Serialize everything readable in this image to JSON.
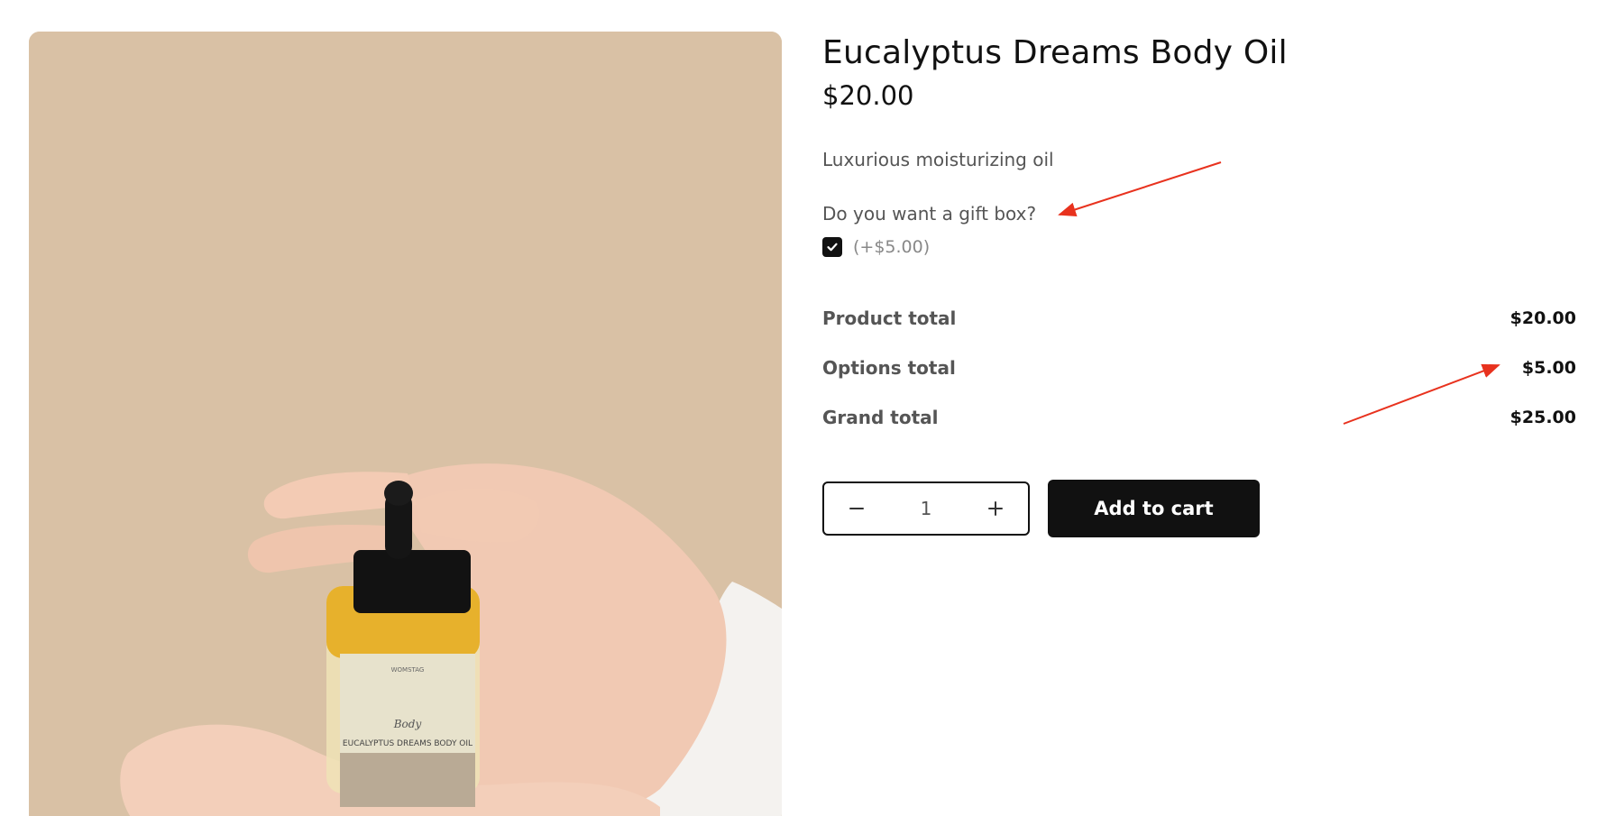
{
  "product": {
    "title": "Eucalyptus Dreams Body Oil",
    "price": "$20.00",
    "description": "Luxurious moisturizing oil",
    "image_label_brand": "WOMSTAG",
    "image_label_category": "Body",
    "image_label_name": "EUCALYPTUS DREAMS BODY OIL"
  },
  "options": {
    "question": "Do you want a gift box?",
    "gift_box_checked": true,
    "gift_box_price": "(+$5.00)"
  },
  "totals": {
    "product_total_label": "Product total",
    "product_total_value": "$20.00",
    "options_total_label": "Options total",
    "options_total_value": "$5.00",
    "grand_total_label": "Grand total",
    "grand_total_value": "$25.00"
  },
  "cart": {
    "quantity": "1",
    "add_to_cart_label": "Add to cart"
  },
  "colors": {
    "accent": "#111111",
    "annotation_arrow": "#e8321e",
    "image_background": "#d9c0a3"
  },
  "icons": {
    "checkbox": "check-icon",
    "decrease": "minus-icon",
    "increase": "plus-icon"
  }
}
